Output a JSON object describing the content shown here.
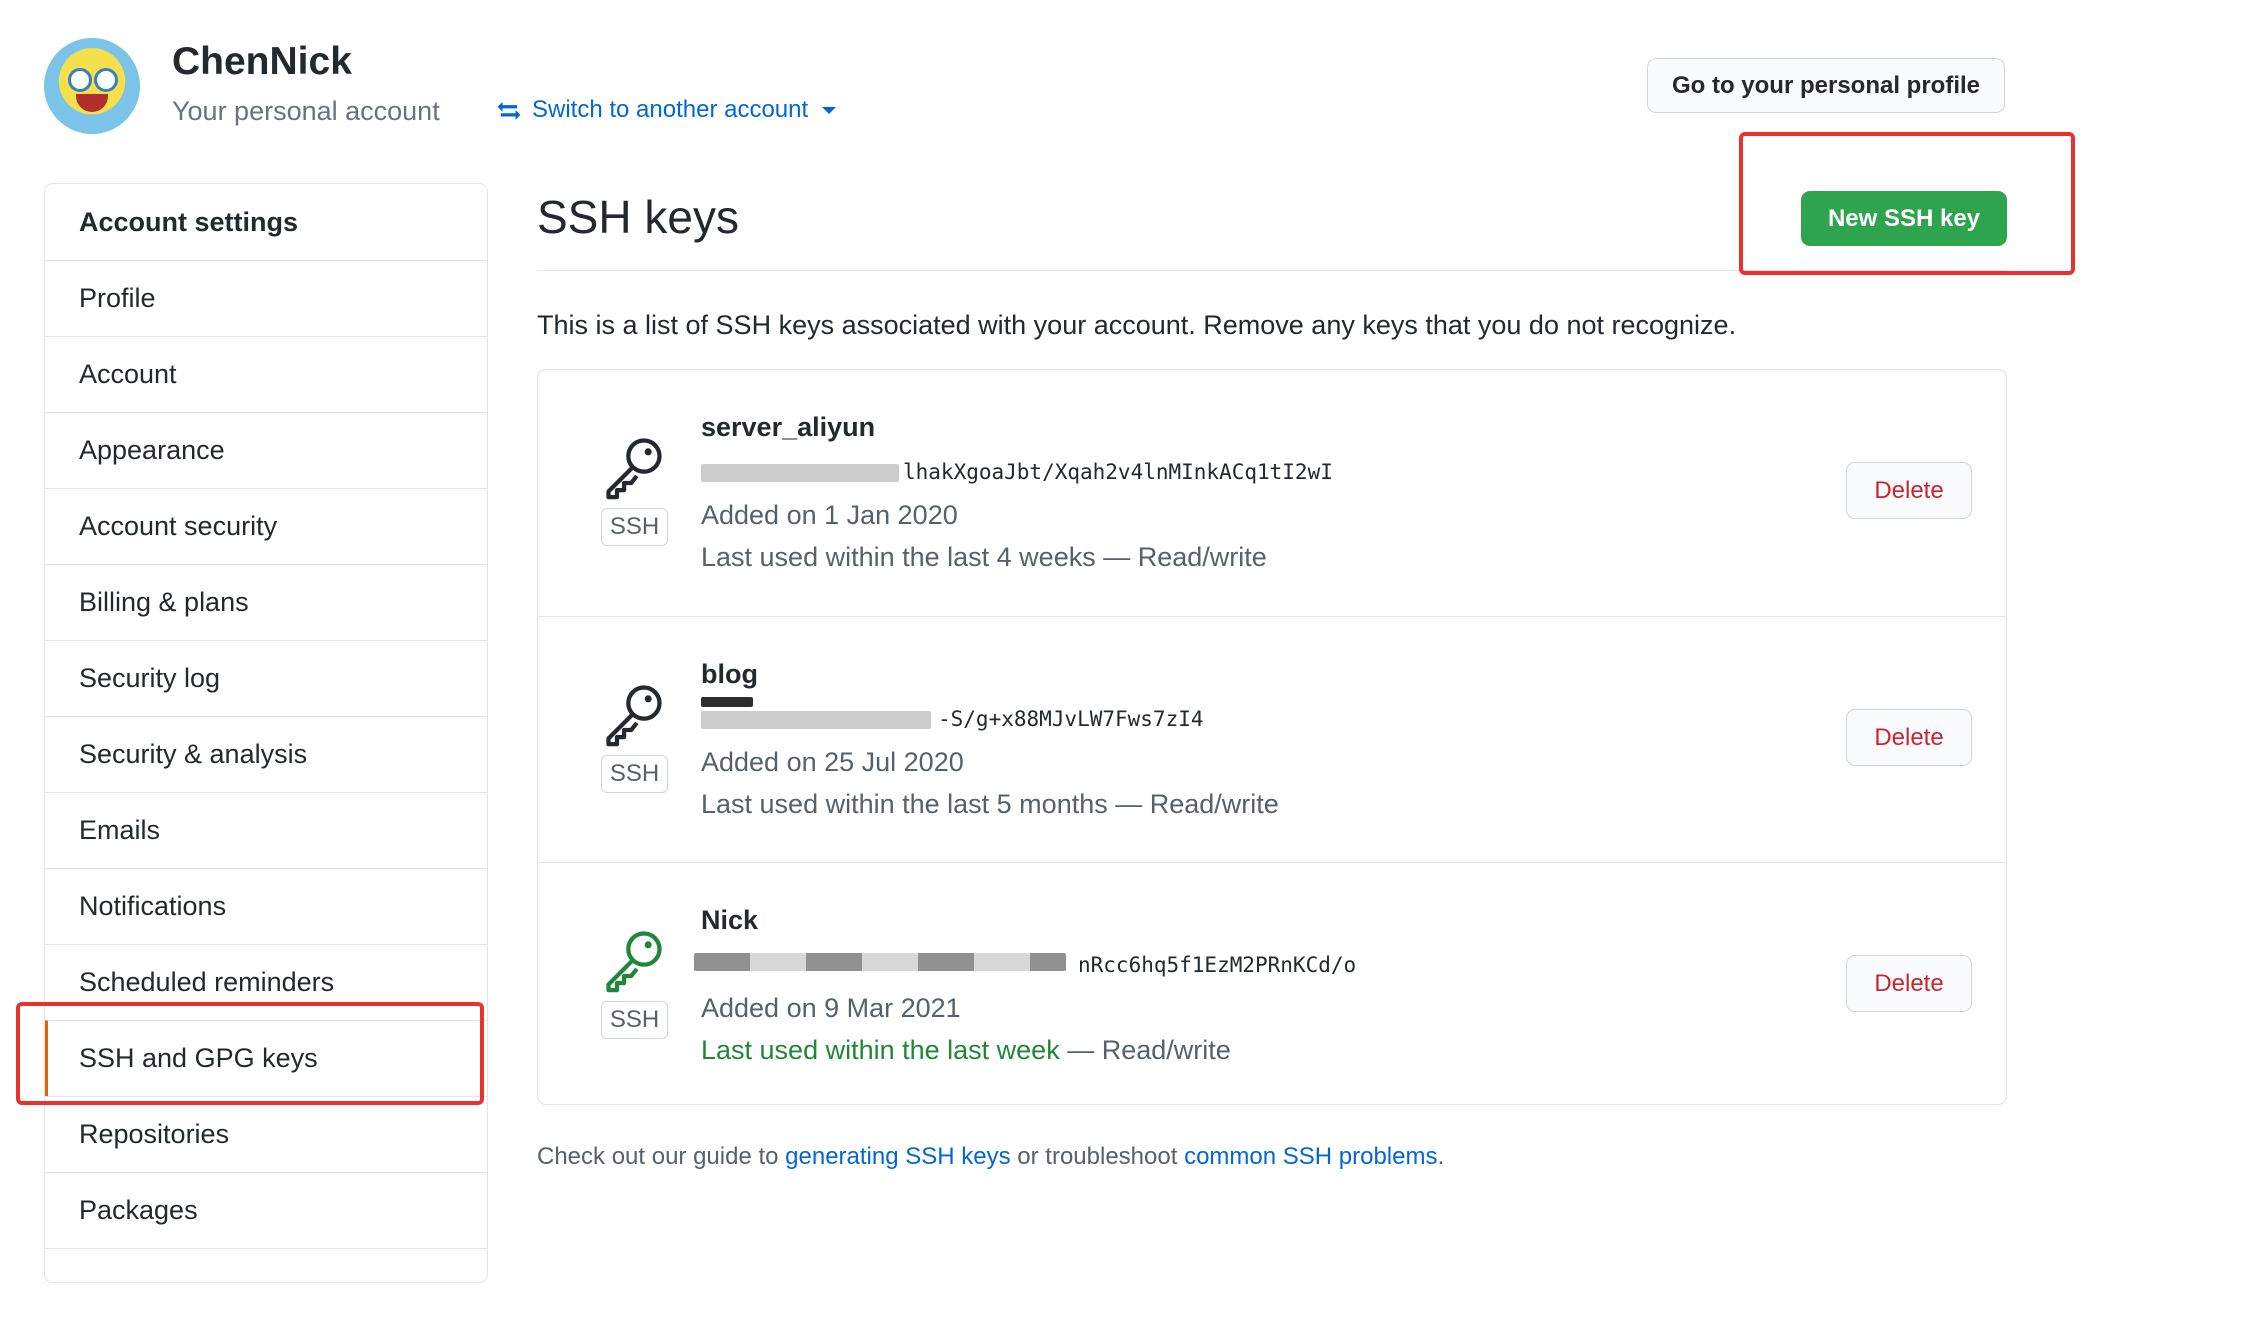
{
  "header": {
    "username": "ChenNick",
    "subtitle": "Your personal account",
    "switch_account_label": "Switch to another account",
    "profile_button_label": "Go to your personal profile",
    "icons": {
      "switch": "switch-arrows-icon",
      "caret": "caret-down-icon",
      "avatar": "avatar-image"
    }
  },
  "sidebar": {
    "header": "Account settings",
    "items": [
      {
        "label": "Profile"
      },
      {
        "label": "Account"
      },
      {
        "label": "Appearance"
      },
      {
        "label": "Account security"
      },
      {
        "label": "Billing & plans"
      },
      {
        "label": "Security log"
      },
      {
        "label": "Security & analysis"
      },
      {
        "label": "Emails"
      },
      {
        "label": "Notifications"
      },
      {
        "label": "Scheduled reminders"
      },
      {
        "label": "SSH and GPG keys",
        "selected": true
      },
      {
        "label": "Repositories"
      },
      {
        "label": "Packages"
      }
    ]
  },
  "main": {
    "title": "SSH keys",
    "new_key_button": "New SSH key",
    "intro": "This is a list of SSH keys associated with your account. Remove any keys that you do not recognize.",
    "keys": [
      {
        "title": "server_aliyun",
        "fingerprint": "SHA256:******************lhakXgoaJbt/Xqah2v4lnMInkACq1tI2wI",
        "fingerprint_visible_tail": "lhakXgoaJbt/Xqah2v4lnMInkACq1tI2wI",
        "added": "Added on 1 Jan 2020",
        "last_used": "Last used within the last 4 weeks",
        "access": " — Read/write",
        "badge": "SSH",
        "delete_label": "Delete",
        "icon": "key-icon",
        "recent": false
      },
      {
        "title": "blog",
        "fingerprint_visible_tail": "-S/g+x88MJvLW7Fws7zI4",
        "added": "Added on 25 Jul 2020",
        "last_used": "Last used within the last 5 months",
        "access": " — Read/write",
        "badge": "SSH",
        "delete_label": "Delete",
        "icon": "key-icon",
        "recent": false
      },
      {
        "title": "Nick",
        "fingerprint_visible_tail": "nRcc6hq5f1EzM2PRnKCd/o",
        "added": "Added on 9 Mar 2021",
        "last_used": "Last used within the last week",
        "access": " — Read/write",
        "badge": "SSH",
        "delete_label": "Delete",
        "icon": "key-icon",
        "recent": true
      }
    ],
    "guide": {
      "prefix": "Check out our guide to ",
      "link1": "generating SSH keys",
      "middle": " or troubleshoot ",
      "link2": "common SSH problems",
      "suffix": "."
    }
  },
  "colors": {
    "primary_green": "#2ea44f",
    "link_blue": "#0366d6",
    "danger_red": "#cb2431",
    "highlight_red": "#e8322b",
    "recent_green": "#22863a",
    "selected_accent": "#e36209"
  }
}
